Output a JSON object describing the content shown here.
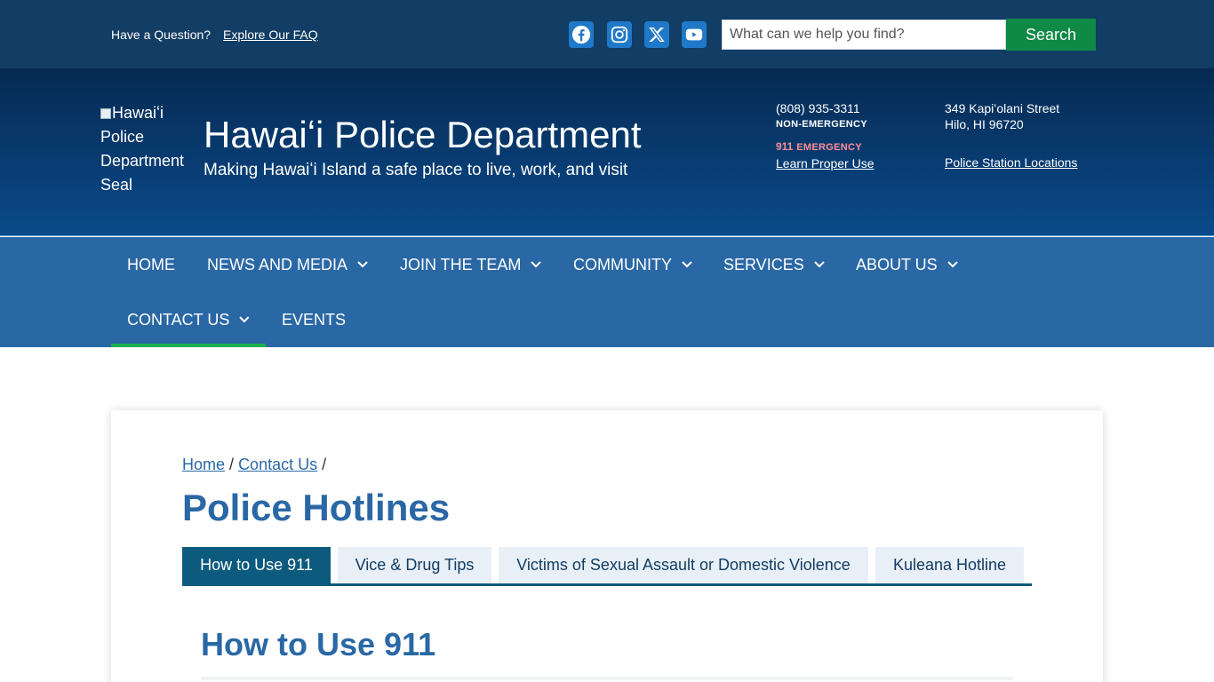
{
  "topbar": {
    "question": "Have a Question?",
    "faq_link": "Explore Our FAQ",
    "social": [
      "facebook-icon",
      "instagram-icon",
      "x-icon",
      "youtube-icon"
    ],
    "search": {
      "placeholder": "What can we help you find?",
      "value": "",
      "button_label": "Search"
    }
  },
  "header": {
    "seal_alt": "Hawaiʻi Police Department Seal",
    "seal_lines": [
      "Hawaiʻi",
      "Police",
      "Department",
      "Seal"
    ],
    "title": "Hawaiʻi Police Department",
    "tagline": "Making Hawaiʻi Island a safe place to live, work, and visit",
    "non_emergency_phone": "(808) 935-3311",
    "non_emergency_label": "NON-EMERGENCY",
    "emergency_number": "911",
    "emergency_label": "EMERGENCY",
    "learn_link": "Learn Proper Use",
    "address_line1": "349 Kapiʻolani Street",
    "address_line2": "Hilo, HI 96720",
    "stations_link": "Police Station Locations"
  },
  "nav": {
    "items": [
      {
        "label": "HOME"
      },
      {
        "label": "NEWS AND MEDIA"
      },
      {
        "label": "JOIN THE TEAM"
      },
      {
        "label": "COMMUNITY"
      },
      {
        "label": "SERVICES"
      },
      {
        "label": "ABOUT US"
      },
      {
        "label": "CONTACT US"
      },
      {
        "label": "EVENTS"
      }
    ],
    "active": "CONTACT US"
  },
  "main": {
    "breadcrumb": {
      "home": "Home",
      "sep": "/",
      "contact": "Contact Us"
    },
    "page_title": "Police Hotlines",
    "tabs": [
      {
        "label": "How to Use 911"
      },
      {
        "label": "Vice & Drug Tips"
      },
      {
        "label": "Victims of Sexual Assault or Domestic Violence"
      },
      {
        "label": "Kuleana Hotline"
      }
    ],
    "active_tab": "How to Use 911",
    "section_title": "How to Use 911"
  },
  "colors": {
    "topbar": "#123d64",
    "header_gradient_top": "#062a52",
    "header_gradient_bottom": "#0a4a8a",
    "nav": "#2a68a5",
    "nav_active_underline": "#15b04f",
    "search_button": "#0e8a45",
    "tab_active": "#0c5a7d",
    "tab_inactive": "#e8eff6",
    "heading": "#2a68a5",
    "emergency": "#ff8e96"
  }
}
